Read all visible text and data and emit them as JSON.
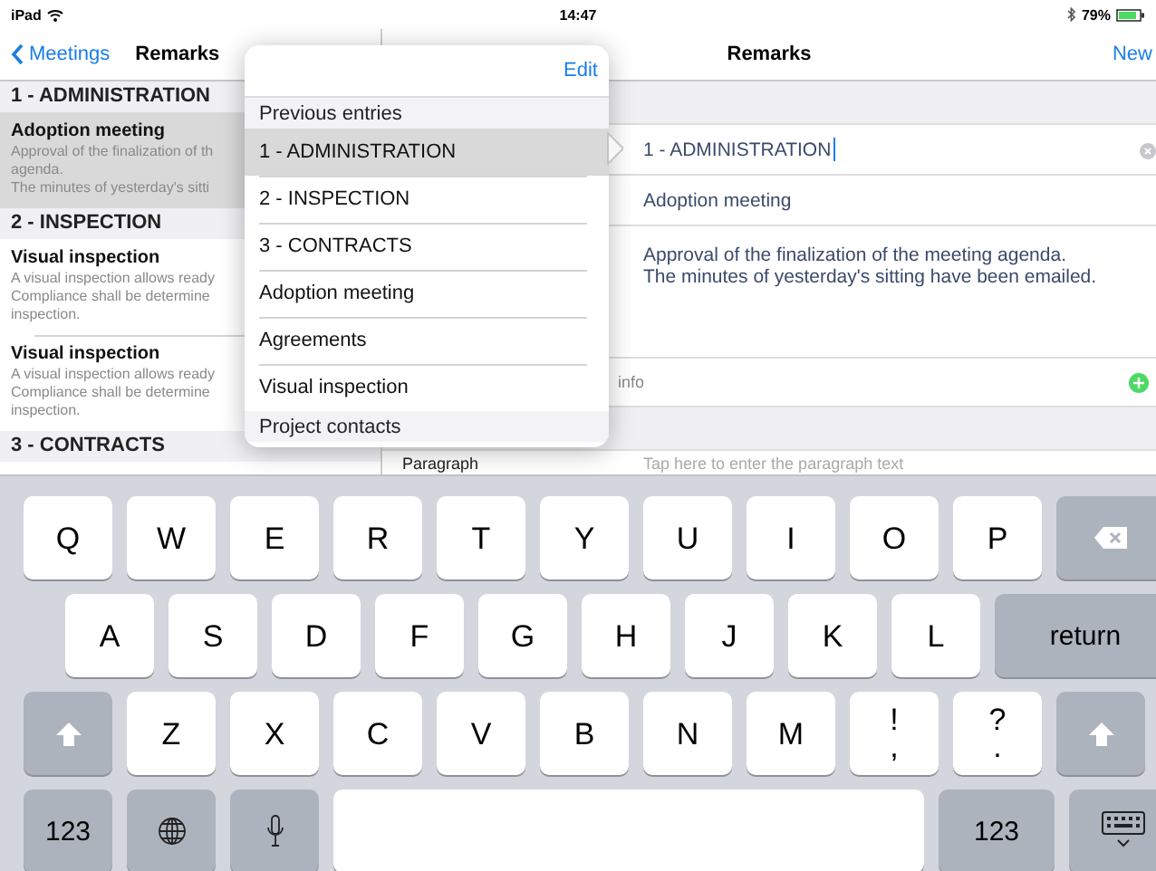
{
  "status_bar": {
    "device": "iPad",
    "time": "14:47",
    "battery": "79%"
  },
  "master": {
    "back": "Meetings",
    "title": "Remarks",
    "sections": [
      {
        "title": "1 - ADMINISTRATION",
        "rows": [
          {
            "title": "Adoption meeting",
            "lines": [
              "Approval of the finalization of th",
              "agenda.",
              "The minutes of yesterday's sitti"
            ],
            "selected": true
          }
        ]
      },
      {
        "title": "2 - INSPECTION",
        "rows": [
          {
            "title": "Visual inspection",
            "lines": [
              "A visual inspection allows ready",
              "Compliance shall be determine",
              "inspection."
            ],
            "selected": false
          },
          {
            "title": "Visual inspection",
            "lines": [
              "A visual inspection allows ready",
              "Compliance shall be determine",
              "inspection."
            ],
            "selected": false
          }
        ]
      },
      {
        "title": "3 - CONTRACTS"
      }
    ]
  },
  "detail": {
    "title": "Remarks",
    "action": "New",
    "fields": [
      {
        "kind": "text",
        "value": "1 - ADMINISTRATION",
        "focused": true
      },
      {
        "kind": "text",
        "value": "Adoption meeting",
        "focused": false
      },
      {
        "kind": "multiline",
        "lines": [
          "Approval of the finalization of the meeting agenda.",
          "The minutes of yesterday's sitting have been emailed."
        ]
      },
      {
        "kind": "add",
        "label": "info"
      },
      {
        "kind": "paragraph",
        "label": "Paragraph",
        "placeholder": "Tap here to enter the paragraph text"
      }
    ]
  },
  "popover": {
    "action": "Edit",
    "sections": [
      {
        "title": "Previous entries",
        "items": [
          {
            "label": "1 - ADMINISTRATION",
            "selected": true
          },
          {
            "label": "2 - INSPECTION",
            "selected": false
          },
          {
            "label": "3 - CONTRACTS",
            "selected": false
          },
          {
            "label": "Adoption meeting",
            "selected": false
          },
          {
            "label": "Agreements",
            "selected": false
          },
          {
            "label": "Visual inspection",
            "selected": false
          }
        ]
      },
      {
        "title": "Project contacts"
      }
    ]
  },
  "keyboard": {
    "rows": [
      {
        "keys": [
          {
            "kind": "letter",
            "label": "Q"
          },
          {
            "kind": "letter",
            "label": "W"
          },
          {
            "kind": "letter",
            "label": "E"
          },
          {
            "kind": "letter",
            "label": "R"
          },
          {
            "kind": "letter",
            "label": "T"
          },
          {
            "kind": "letter",
            "label": "Y"
          },
          {
            "kind": "letter",
            "label": "U"
          },
          {
            "kind": "letter",
            "label": "I"
          },
          {
            "kind": "letter",
            "label": "O"
          },
          {
            "kind": "letter",
            "label": "P"
          },
          {
            "kind": "backspace"
          }
        ]
      },
      {
        "keys": [
          {
            "kind": "letter",
            "label": "A"
          },
          {
            "kind": "letter",
            "label": "S"
          },
          {
            "kind": "letter",
            "label": "D"
          },
          {
            "kind": "letter",
            "label": "F"
          },
          {
            "kind": "letter",
            "label": "G"
          },
          {
            "kind": "letter",
            "label": "H"
          },
          {
            "kind": "letter",
            "label": "J"
          },
          {
            "kind": "letter",
            "label": "K"
          },
          {
            "kind": "letter",
            "label": "L"
          },
          {
            "kind": "return",
            "label": "return"
          }
        ]
      },
      {
        "keys": [
          {
            "kind": "shift"
          },
          {
            "kind": "letter",
            "label": "Z"
          },
          {
            "kind": "letter",
            "label": "X"
          },
          {
            "kind": "letter",
            "label": "C"
          },
          {
            "kind": "letter",
            "label": "V"
          },
          {
            "kind": "letter",
            "label": "B"
          },
          {
            "kind": "letter",
            "label": "N"
          },
          {
            "kind": "letter",
            "label": "M"
          },
          {
            "kind": "dual",
            "labels": [
              "!",
              ","
            ]
          },
          {
            "kind": "dual",
            "labels": [
              "?",
              "."
            ]
          },
          {
            "kind": "shift"
          }
        ]
      },
      {
        "keys": [
          {
            "kind": "numbers",
            "label": "123"
          },
          {
            "kind": "globe"
          },
          {
            "kind": "mic"
          },
          {
            "kind": "space"
          },
          {
            "kind": "numbers",
            "label": "123"
          },
          {
            "kind": "hide"
          }
        ]
      }
    ]
  }
}
